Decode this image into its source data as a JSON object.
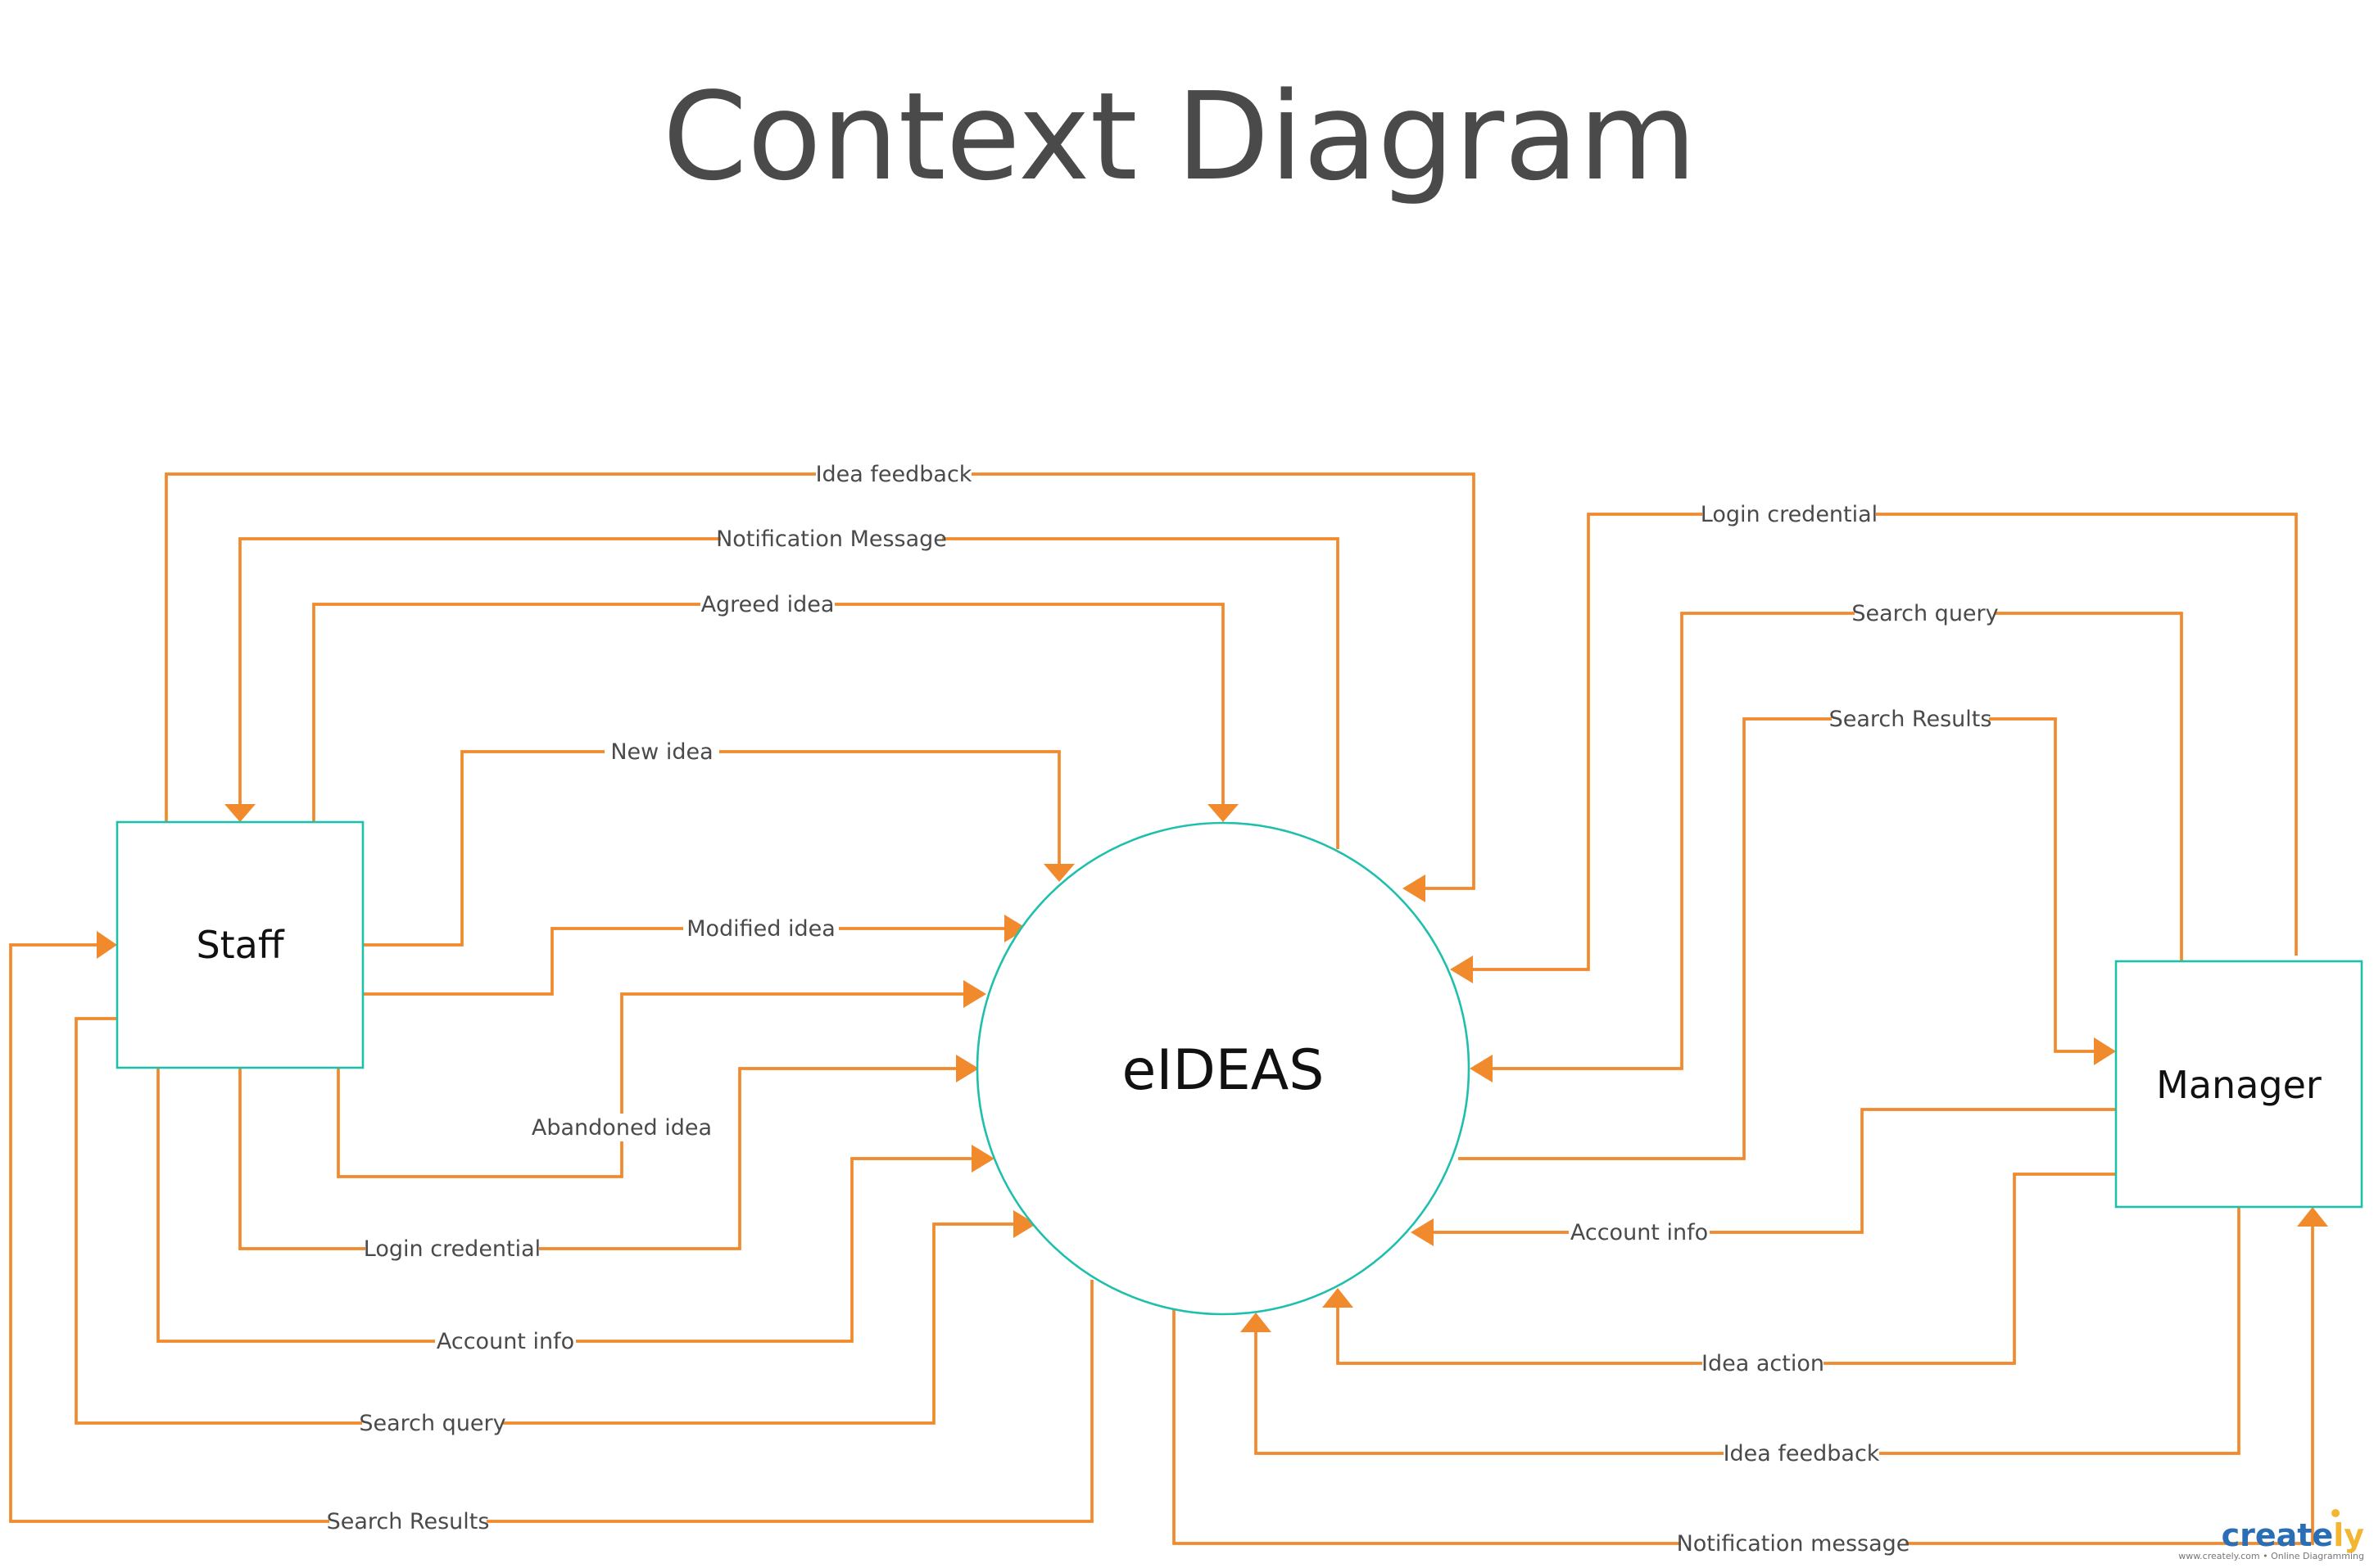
{
  "title": "Context Diagram",
  "process": {
    "label": "eIDEAS"
  },
  "entities": {
    "staff": "Staff",
    "manager": "Manager"
  },
  "flows": {
    "staff_idea_feedback": "Idea feedback",
    "staff_notification_message": "Notification Message",
    "staff_agreed_idea": "Agreed idea",
    "staff_new_idea": "New idea",
    "staff_modified_idea": "Modified idea",
    "staff_abandoned_idea": "Abandoned idea",
    "staff_login_credential": "Login credential",
    "staff_account_info": "Account info",
    "staff_search_query": "Search query",
    "staff_search_results": "Search Results",
    "manager_login_credential": "Login credential",
    "manager_search_query": "Search query",
    "manager_search_results": "Search Results",
    "manager_account_info": "Account info",
    "manager_idea_action": "Idea action",
    "manager_idea_feedback": "Idea feedback",
    "manager_notification_message": "Notification message"
  },
  "watermark": {
    "logo_main": "create",
    "logo_accent": "ly",
    "tagline": "www.creately.com • Online Diagramming"
  },
  "colors": {
    "flow": "#f08a2c",
    "outline": "#1fbfad",
    "text": "#4a4a4a"
  }
}
